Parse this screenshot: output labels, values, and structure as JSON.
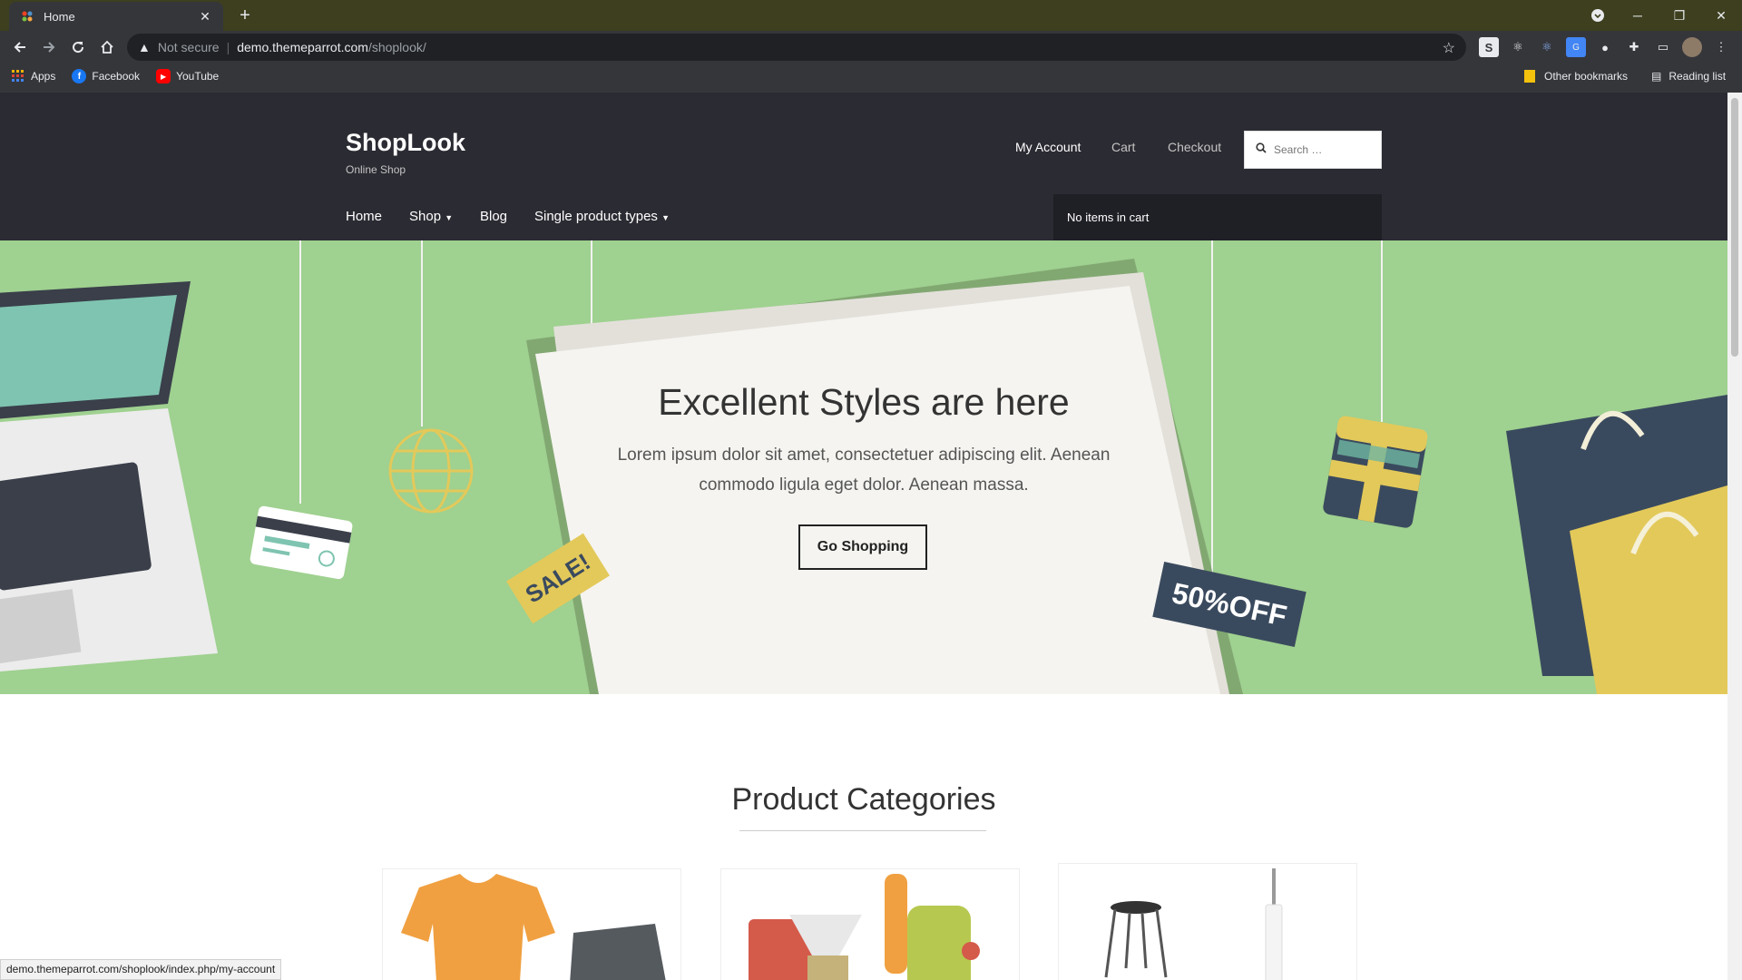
{
  "browser": {
    "tab_title": "Home",
    "new_tab_symbol": "+",
    "url_security": "Not secure",
    "url_host": "demo.themeparrot.com",
    "url_path": "/shoplook/",
    "bookmarks": [
      "Apps",
      "Facebook",
      "YouTube"
    ],
    "other_bookmarks": "Other bookmarks",
    "reading_list": "Reading list",
    "status_url": "demo.themeparrot.com/shoplook/index.php/my-account"
  },
  "site": {
    "title": "ShopLook",
    "description": "Online Shop",
    "top_nav": {
      "my_account": "My Account",
      "cart": "Cart",
      "checkout": "Checkout"
    },
    "search_placeholder": "Search …",
    "main_nav": {
      "home": "Home",
      "shop": "Shop",
      "blog": "Blog",
      "single": "Single product types"
    },
    "cart_status": "No items in cart"
  },
  "hero": {
    "title": "Excellent Styles are here",
    "text": "Lorem ipsum dolor sit amet, consectetuer adipiscing elit. Aenean commodo ligula eget dolor. Aenean massa.",
    "button": "Go Shopping",
    "sale_tag": "SALE!",
    "discount_tag": "50%OFF"
  },
  "sections": {
    "product_categories": "Product Categories"
  },
  "colors": {
    "header_bg": "#2b2b33",
    "hero_bg": "#9fd190",
    "accent_yellow": "#e3c95a"
  }
}
